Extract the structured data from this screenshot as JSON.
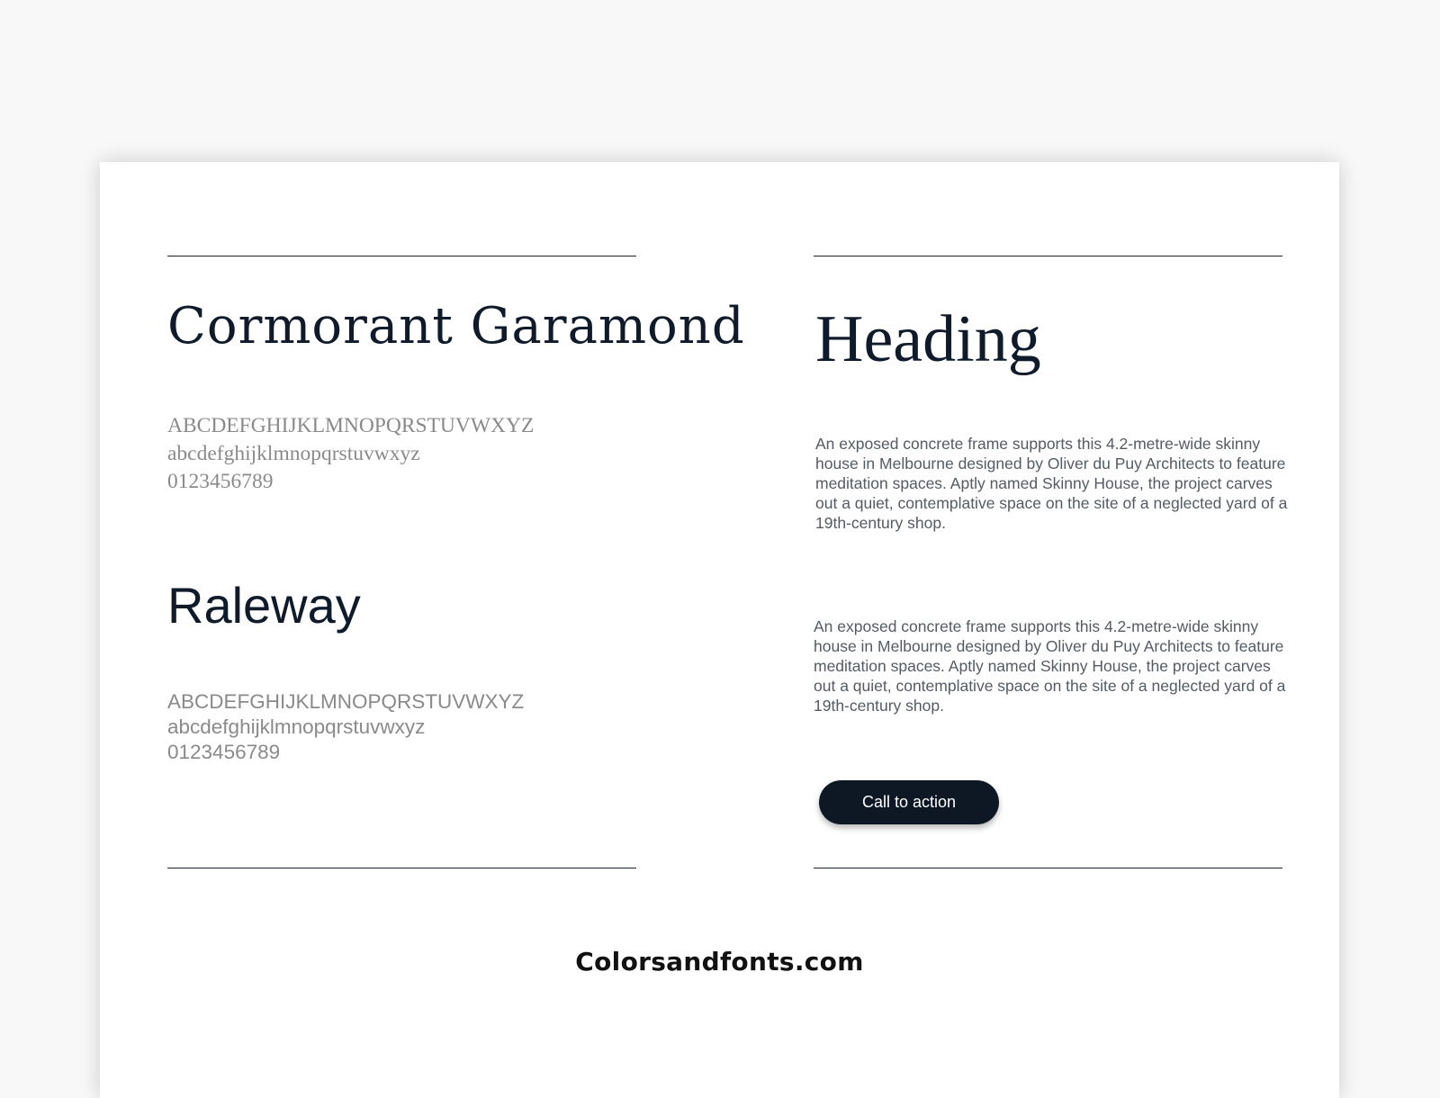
{
  "left": {
    "font1": {
      "name": "Cormorant Garamond",
      "uppercase": "ABCDEFGHIJKLMNOPQRSTUVWXYZ",
      "lowercase": "abcdefghijklmnopqrstuvwxyz",
      "digits": "0123456789"
    },
    "font2": {
      "name": "Raleway",
      "uppercase": "ABCDEFGHIJKLMNOPQRSTUVWXYZ",
      "lowercase": "abcdefghijklmnopqrstuvwxyz",
      "digits": "0123456789"
    }
  },
  "right": {
    "heading": "Heading",
    "paragraph1": "An exposed concrete frame supports this 4.2-metre-wide skinny house in Melbourne designed by Oliver du Puy Architects to feature meditation spaces. Aptly named Skinny House, the project carves out a quiet, contemplative space on the site of a neglected yard of a 19th-century shop.",
    "paragraph2": "An exposed concrete frame supports this 4.2-metre-wide skinny house in Melbourne designed by Oliver du Puy Architects to feature meditation spaces. Aptly named Skinny House, the project carves out a quiet, contemplative space on the site of a neglected yard of a 19th-century shop.",
    "cta_label": "Call to action"
  },
  "footer": {
    "site": "Colorsandfonts.com"
  },
  "colors": {
    "page_background": "#f8f8f8",
    "card_background": "#ffffff",
    "heading_text": "#0f1b2a",
    "specimen_text": "#8a8a8a",
    "body_text": "#555b63",
    "button_background": "#0d1824",
    "button_text": "#ffffff"
  }
}
